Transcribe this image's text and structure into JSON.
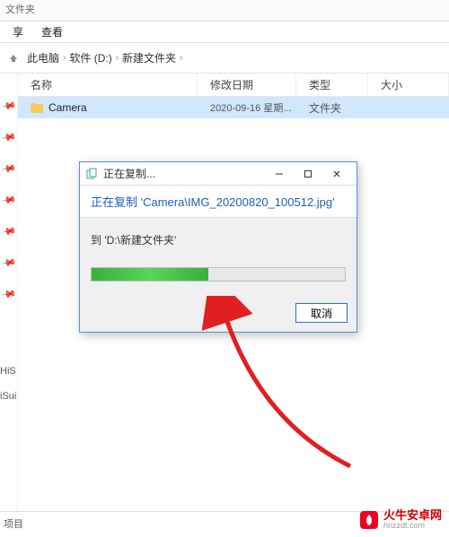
{
  "tabbar": {
    "title": "文件夹"
  },
  "menubar": {
    "share": "享",
    "view": "查看"
  },
  "breadcrumbs": {
    "root": "此电脑",
    "drive": "软件 (D:)",
    "folder": "新建文件夹"
  },
  "columns": {
    "name": "名称",
    "date": "修改日期",
    "type": "类型",
    "size": "大小"
  },
  "rows": [
    {
      "name": "Camera",
      "date": "2020-09-16 星期...",
      "type": "文件夹"
    }
  ],
  "sidebar_lower": {
    "a": "HiS",
    "b": "iSui"
  },
  "statusbar": {
    "text": "项目"
  },
  "dialog": {
    "title": "正在复制...",
    "headline": "正在复制 'Camera\\IMG_20200820_100512.jpg'",
    "destination": "到 'D:\\新建文件夹'",
    "cancel": "取消",
    "progress_percent": 46
  },
  "branding": {
    "cn": "火牛安卓网",
    "en": "hnzzdt.com"
  }
}
